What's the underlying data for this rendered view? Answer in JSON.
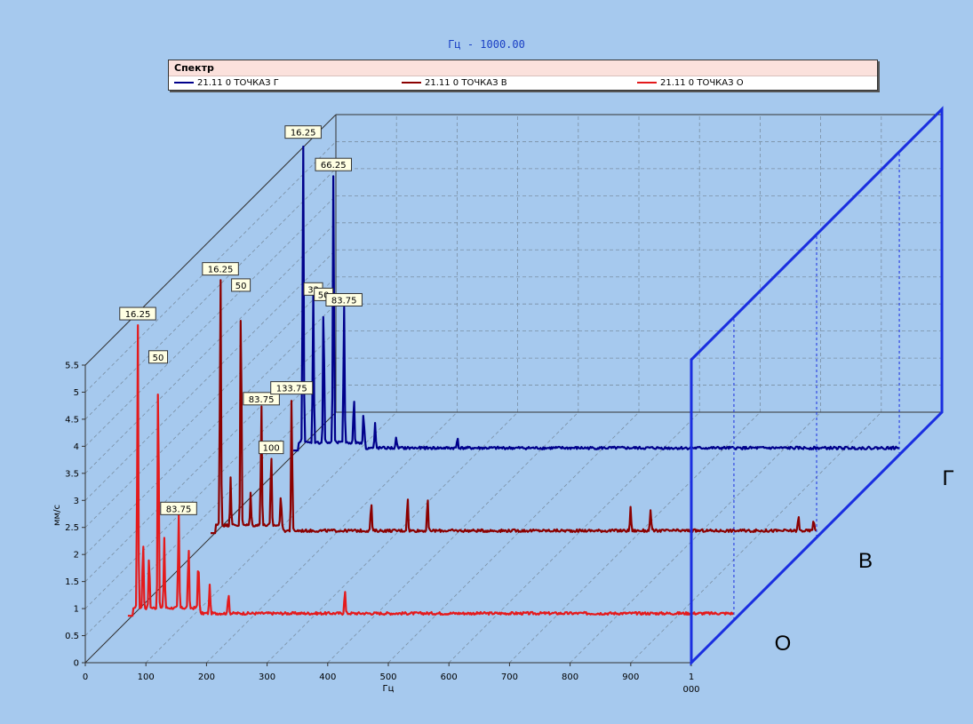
{
  "title": "Гц - 1000.00",
  "legend": {
    "title": "Спектр",
    "items": [
      {
        "label": "21.11 0 ТОЧКАЗ Г",
        "color": "#00008b"
      },
      {
        "label": "21.11 0 ТОЧКАЗ В",
        "color": "#8b0000"
      },
      {
        "label": "21.11 0 ТОЧКАЗ О",
        "color": "#e41a1c"
      }
    ]
  },
  "chart_data": {
    "type": "line",
    "xlabel": "Гц",
    "ylabel": "мм/с",
    "xlim": [
      0,
      1000
    ],
    "ylim": [
      0,
      5.5
    ],
    "x_ticks": [
      "0",
      "100",
      "200",
      "300",
      "400",
      "500",
      "600",
      "700",
      "800",
      "900",
      "1\n000"
    ],
    "y_ticks": [
      "0",
      "0.5",
      "1",
      "1.5",
      "2",
      "2.5",
      "3",
      "3.5",
      "4",
      "4.5",
      "5",
      "5.5"
    ],
    "depth_labels": [
      "О",
      "В",
      "Г"
    ],
    "grid": true,
    "legend_position": "top",
    "series": [
      {
        "name": "21.11 0 ТОЧКАЗ О",
        "color": "#e41a1c",
        "baseline": 0.1,
        "peaks": [
          [
            16.25,
            5.4
          ],
          [
            50,
            4.6
          ],
          [
            83.75,
            1.8
          ],
          [
            25,
            1.3
          ],
          [
            35,
            1.0
          ],
          [
            60,
            1.3
          ],
          [
            100,
            1.2
          ],
          [
            116.25,
            0.95
          ],
          [
            135,
            0.55
          ],
          [
            166,
            0.4
          ],
          [
            358,
            0.45
          ]
        ],
        "labels": [
          [
            16.25,
            "16.25"
          ],
          [
            50,
            "50"
          ],
          [
            83.75,
            "83.75"
          ]
        ]
      },
      {
        "name": "21.11 0 ТОЧКАЗ В",
        "color": "#8b0000",
        "baseline": 0.1,
        "peaks": [
          [
            16.25,
            4.7
          ],
          [
            50,
            4.4
          ],
          [
            83.75,
            2.3
          ],
          [
            100,
            1.4
          ],
          [
            133.75,
            2.5
          ],
          [
            33,
            0.9
          ],
          [
            66,
            0.6
          ],
          [
            116,
            0.6
          ],
          [
            265,
            0.55
          ],
          [
            325,
            0.65
          ],
          [
            358,
            0.62
          ],
          [
            693,
            0.45
          ],
          [
            726,
            0.4
          ],
          [
            970,
            0.28
          ],
          [
            995,
            0.22
          ]
        ],
        "labels": [
          [
            16.25,
            "16.25"
          ],
          [
            50,
            "50"
          ],
          [
            83.75,
            "83.75"
          ],
          [
            100,
            "100"
          ],
          [
            133.75,
            "133.75"
          ]
        ]
      },
      {
        "name": "21.11 0 ТОЧКАЗ Г",
        "color": "#00008b",
        "baseline": 0.1,
        "peaks": [
          [
            16.25,
            5.7
          ],
          [
            33,
            2.8
          ],
          [
            50,
            2.7
          ],
          [
            66.25,
            5.1
          ],
          [
            83.75,
            2.6
          ],
          [
            100,
            0.85
          ],
          [
            116,
            0.55
          ],
          [
            135,
            0.45
          ],
          [
            170,
            0.2
          ],
          [
            271,
            0.2
          ]
        ],
        "labels": [
          [
            16.25,
            "16.25"
          ],
          [
            33,
            "33"
          ],
          [
            50,
            "50"
          ],
          [
            66.25,
            "66.25"
          ],
          [
            83.75,
            "83.75"
          ]
        ]
      }
    ]
  }
}
